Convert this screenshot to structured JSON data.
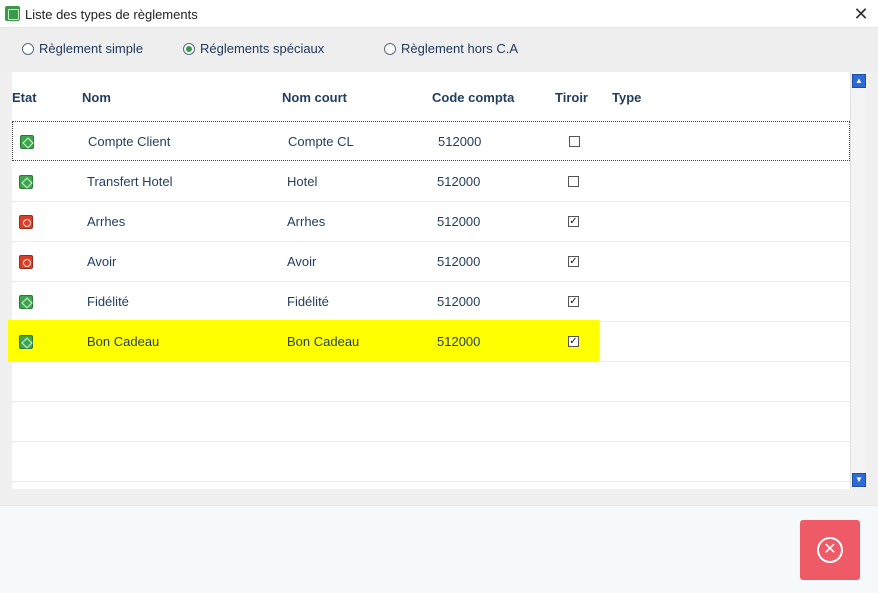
{
  "window": {
    "title": "Liste des types de règlements",
    "close_glyph": "✕",
    "app_icon": "app-icon"
  },
  "radio": {
    "options": [
      {
        "label": "Règlement simple",
        "selected": false
      },
      {
        "label": "Réglements spéciaux",
        "selected": true
      },
      {
        "label": "Règlement hors C.A",
        "selected": false
      }
    ]
  },
  "grid": {
    "columns": [
      "Etat",
      "Nom",
      "Nom court",
      "Code compta",
      "Tiroir",
      "Type"
    ],
    "rows": [
      {
        "etat": "green-status-icon",
        "nom": "Compte Client",
        "nom_court": "Compte CL",
        "code": "512000",
        "tiroir": false
      },
      {
        "etat": "green-status-icon",
        "nom": "Transfert Hotel",
        "nom_court": "Hotel",
        "code": "512000",
        "tiroir": false
      },
      {
        "etat": "red-status-icon",
        "nom": "Arrhes",
        "nom_court": "Arrhes",
        "code": "512000",
        "tiroir": true
      },
      {
        "etat": "red-status-icon",
        "nom": "Avoir",
        "nom_court": "Avoir",
        "code": "512000",
        "tiroir": true
      },
      {
        "etat": "green-status-icon",
        "nom": "Fidélité",
        "nom_court": "Fidélité",
        "code": "512000",
        "tiroir": true
      },
      {
        "etat": "green-status-icon",
        "nom": "Bon Cadeau",
        "nom_court": "Bon Cadeau",
        "code": "512000",
        "tiroir": true
      }
    ],
    "highlight_color": "#ffff00",
    "check_glyph": "✓"
  },
  "scrollbar": {
    "up_glyph": "▲",
    "down_glyph": "▼"
  },
  "footer": {
    "close_glyph": "✕",
    "close_color": "#ee5a66"
  }
}
